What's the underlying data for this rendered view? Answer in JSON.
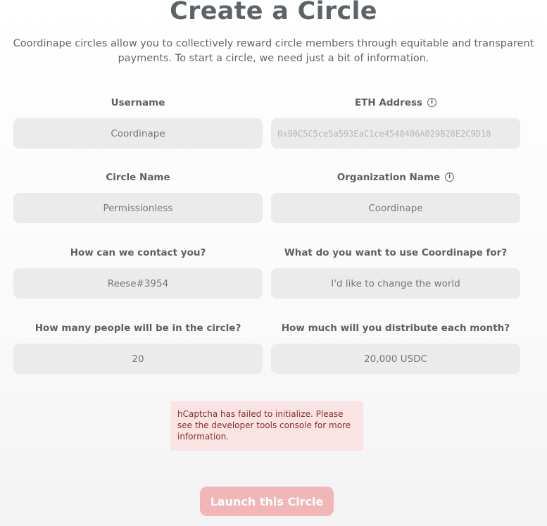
{
  "page": {
    "title": "Create a Circle",
    "intro": "Coordinape circles allow you to collectively reward circle members through equitable and transparent payments. To start a circle, we need just a bit of information."
  },
  "fields": {
    "username": {
      "label": "Username",
      "value": "Coordinape"
    },
    "eth_address": {
      "label": "ETH Address",
      "value": "0x90C5C5ce5a593EaC1ce4548406A029B28E2C9D10",
      "info_icon": "info-icon"
    },
    "circle_name": {
      "label": "Circle Name",
      "value": "Permissionless"
    },
    "organization_name": {
      "label": "Organization Name",
      "value": "Coordinape",
      "info_icon": "info-icon"
    },
    "contact": {
      "label": "How can we contact you?",
      "value": "Reese#3954"
    },
    "use_for": {
      "label": "What do you want to use Coordinape for?",
      "value": "I'd like to change the world"
    },
    "people": {
      "label": "How many people will be in the circle?",
      "value": "20"
    },
    "distribute": {
      "label": "How much will you distribute each month?",
      "value": "20,000 USDC"
    }
  },
  "captcha": {
    "message": "hCaptcha has failed to initialize. Please see the developer tools console for more information."
  },
  "launch_button": {
    "label": "Launch this Circle"
  },
  "colors": {
    "title": "#5d6468",
    "input_bg": "#ebebeb",
    "error_bg": "#fae3e3",
    "error_text": "#8a2e2e",
    "button_bg": "#f2b6b6"
  }
}
